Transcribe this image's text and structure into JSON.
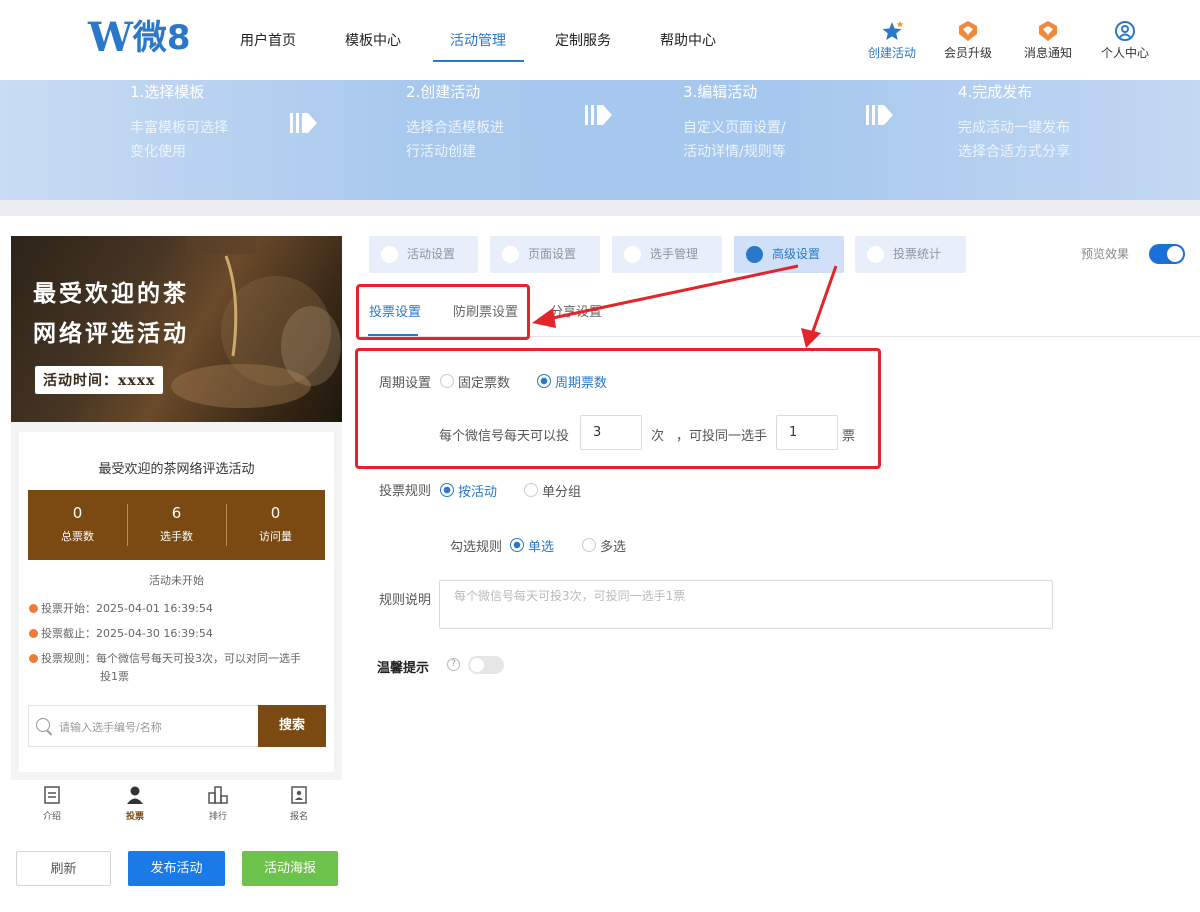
{
  "brand": {
    "logo_text": "微8",
    "logo_mark": "W",
    "color": "#2a78c9"
  },
  "nav": {
    "items": [
      "用户首页",
      "模板中心",
      "活动管理",
      "定制服务",
      "帮助中心"
    ],
    "active_index": 2
  },
  "tools": {
    "create": "创建活动",
    "upgrade": "会员升级",
    "notify": "消息通知",
    "profile": "个人中心"
  },
  "steps": [
    {
      "title": "1.选择模板",
      "desc1": "丰富模板可选择",
      "desc2": "变化使用"
    },
    {
      "title": "2.创建活动",
      "desc1": "选择合适模板进",
      "desc2": "行活动创建"
    },
    {
      "title": "3.编辑活动",
      "desc1": "自定义页面设置/",
      "desc2": "活动详情/规则等"
    },
    {
      "title": "4.完成发布",
      "desc1": "完成活动一键发布",
      "desc2": "选择合适方式分享"
    }
  ],
  "preview": {
    "hero_line1": "最受欢迎的茶",
    "hero_line2": "网络评选活动",
    "hero_time": "活动时间：xxxx",
    "card_title": "最受欢迎的茶网络评选活动",
    "stats": [
      {
        "value": "0",
        "label": "总票数"
      },
      {
        "value": "6",
        "label": "选手数"
      },
      {
        "value": "0",
        "label": "访问量"
      }
    ],
    "status": "活动未开始",
    "vote_start": "投票开始：2025-04-01 16:39:54",
    "vote_end": "投票截止：2025-04-30 16:39:54",
    "vote_rule_1": "投票规则：每个微信号每天可投3次，可以对同一选手",
    "vote_rule_2": "投1票",
    "search_placeholder": "请输入选手编号/名称",
    "search_button": "搜索",
    "accent": "#7a4a12",
    "tabbar": [
      {
        "label": "介绍",
        "icon": "document-icon"
      },
      {
        "label": "投票",
        "icon": "user-icon"
      },
      {
        "label": "排行",
        "icon": "ranking-icon"
      },
      {
        "label": "报名",
        "icon": "signup-icon"
      }
    ]
  },
  "actions": {
    "refresh": "刷新",
    "publish": "发布活动",
    "poster": "活动海报"
  },
  "settings_tabs": [
    "活动设置",
    "页面设置",
    "选手管理",
    "高级设置",
    "投票统计"
  ],
  "settings_active": "高级设置",
  "preview_effect": {
    "label": "预览效果",
    "enabled": true
  },
  "subtabs": [
    "投票设置",
    "防刷票设置",
    "分享设置"
  ],
  "form": {
    "cycle_label": "周期设置",
    "cycle_options": [
      "固定票数",
      "周期票数"
    ],
    "cycle_selected": "周期票数",
    "per_day_prefix": "每个微信号每天可以投",
    "per_day_value": "3",
    "per_day_unit": "次",
    "same_player_prefix": "，可投同一选手",
    "same_player_value": "1",
    "same_player_unit": "票",
    "rule_label": "投票规则",
    "rule_options": [
      "按活动",
      "单分组"
    ],
    "rule_selected": "按活动",
    "select_label": "勾选规则",
    "select_options": [
      "单选",
      "多选"
    ],
    "select_selected": "单选",
    "desc_label": "规则说明",
    "desc_placeholder": "每个微信号每天可投3次，可投同一选手1票",
    "tip_label": "温馨提示",
    "tip_enabled": false
  }
}
